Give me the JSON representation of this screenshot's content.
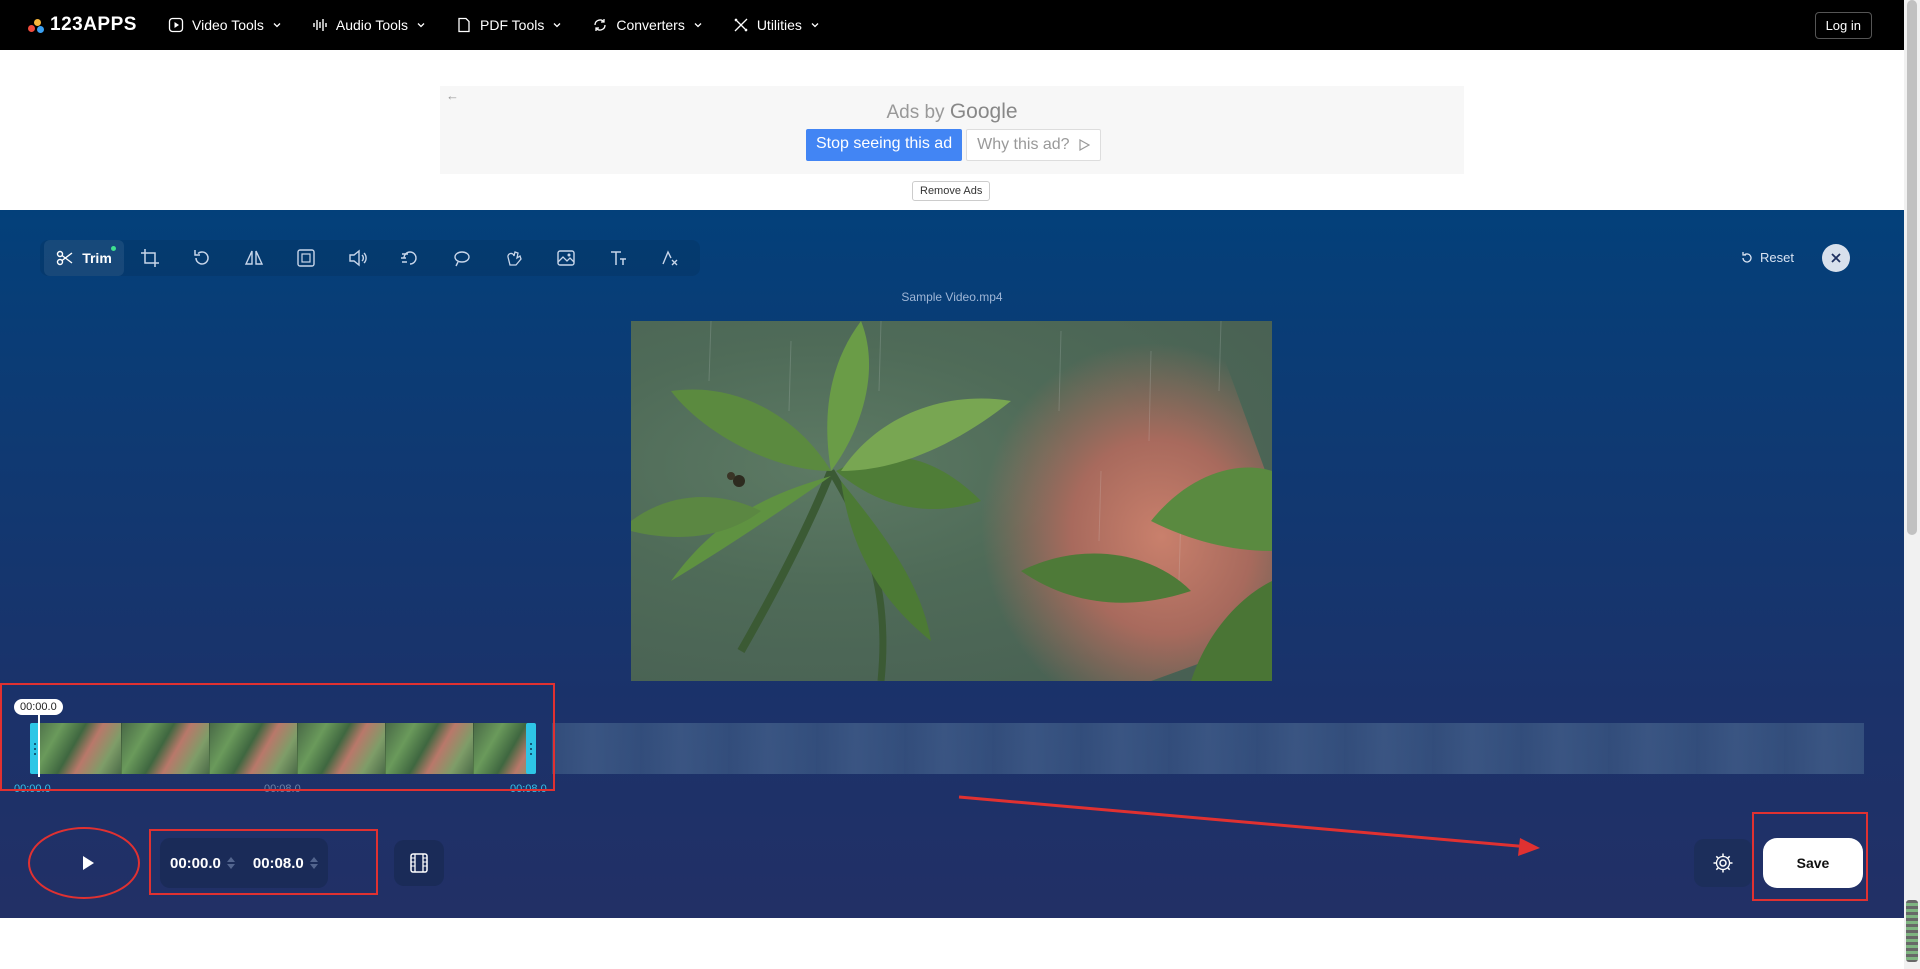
{
  "nav": {
    "logo_text": "123APPS",
    "items": [
      {
        "label": "Video Tools",
        "icon": "video-icon"
      },
      {
        "label": "Audio Tools",
        "icon": "audio-wave-icon"
      },
      {
        "label": "PDF Tools",
        "icon": "document-icon"
      },
      {
        "label": "Converters",
        "icon": "convert-icon"
      },
      {
        "label": "Utilities",
        "icon": "tools-icon"
      }
    ],
    "login_label": "Log in"
  },
  "ad": {
    "ads_by": "Ads by",
    "google": "Google",
    "stop_label": "Stop seeing this ad",
    "why_label": "Why this ad?",
    "remove_label": "Remove Ads"
  },
  "editor": {
    "trim_label": "Trim",
    "reset_label": "Reset",
    "filename": "Sample Video.mp4",
    "tools": [
      "crop-icon",
      "rotate-icon",
      "flip-icon",
      "resize-icon",
      "volume-icon",
      "speed-icon",
      "loop-icon",
      "stabilize-icon",
      "image-icon",
      "text-icon",
      "remove-logo-icon"
    ]
  },
  "timeline": {
    "playhead": "00:00.0",
    "start": "00:00.0",
    "mid": "00:08.0",
    "end": "00:08.0"
  },
  "controls": {
    "start_time": "00:00.0",
    "end_time": "00:08.0",
    "save_label": "Save"
  },
  "colors": {
    "accent": "#2ec6e6",
    "annotation": "#e03131",
    "editor_top": "#03407a",
    "editor_bottom": "#223066"
  }
}
